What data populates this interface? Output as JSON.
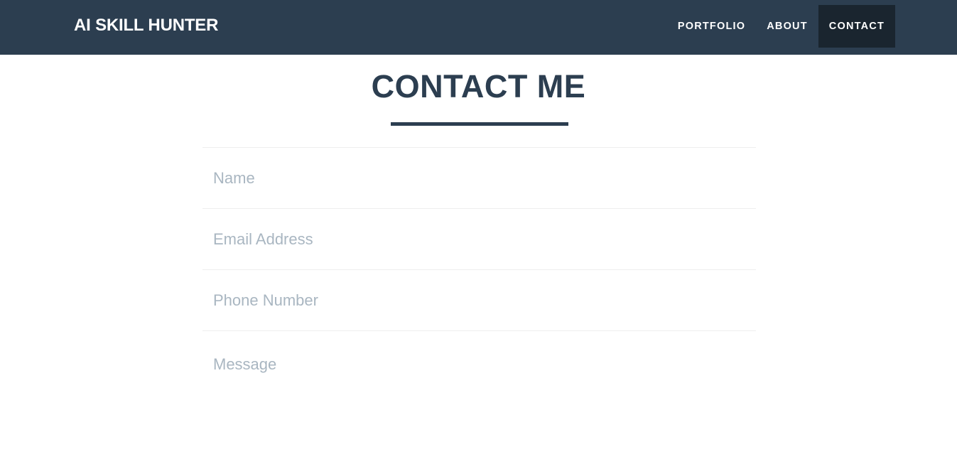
{
  "navbar": {
    "brand": "AI SKILL HUNTER",
    "links": [
      {
        "label": "PORTFOLIO",
        "active": false
      },
      {
        "label": "ABOUT",
        "active": false
      },
      {
        "label": "CONTACT",
        "active": true
      }
    ]
  },
  "section": {
    "title": "CONTACT ME"
  },
  "form": {
    "name_placeholder": "Name",
    "email_placeholder": "Email Address",
    "phone_placeholder": "Phone Number",
    "message_placeholder": "Message"
  },
  "colors": {
    "navbar_bg": "#2c3e50",
    "active_link_bg": "#1a252f",
    "title": "#2c3e50",
    "placeholder": "#a9b6c1"
  }
}
